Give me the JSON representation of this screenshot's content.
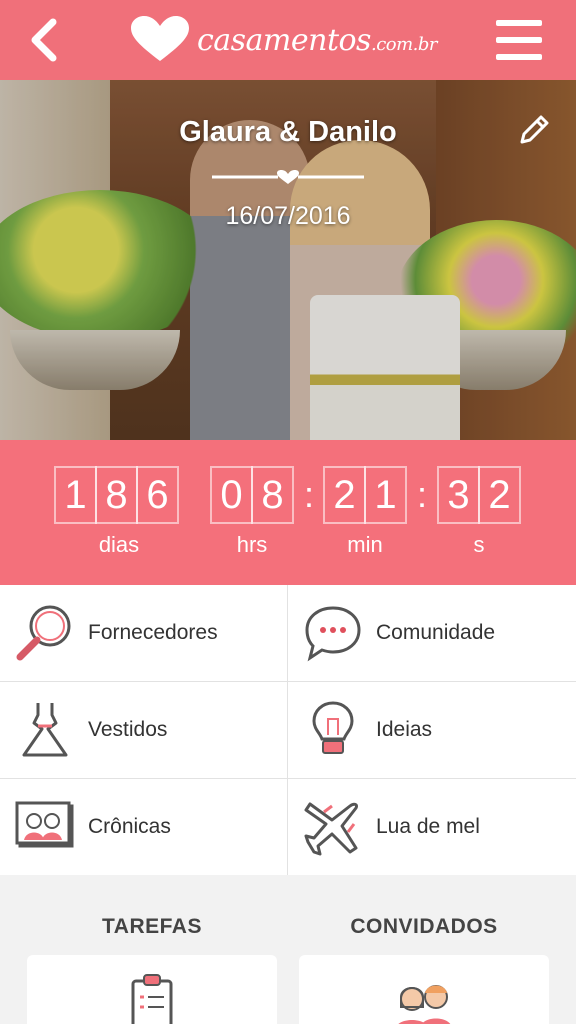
{
  "header": {
    "logo_text": "casamentos",
    "logo_suffix": ".com.br",
    "back_icon": "chevron-left-icon",
    "menu_icon": "hamburger-menu-icon",
    "color": "#f0707a"
  },
  "hero": {
    "couple": "Glaura & Danilo",
    "date": "16/07/2016",
    "edit_icon": "pencil-icon"
  },
  "countdown": {
    "days": [
      "1",
      "8",
      "6"
    ],
    "hours": [
      "0",
      "8"
    ],
    "minutes": [
      "2",
      "1"
    ],
    "seconds": [
      "3",
      "2"
    ],
    "labels": {
      "days": "dias",
      "hours": "hrs",
      "minutes": "min",
      "seconds": "s"
    },
    "color": "#f4707b"
  },
  "menu": [
    {
      "label": "Fornecedores",
      "icon": "magnifier-icon"
    },
    {
      "label": "Comunidade",
      "icon": "chat-bubble-icon"
    },
    {
      "label": "Vestidos",
      "icon": "dress-icon"
    },
    {
      "label": "Ideias",
      "icon": "lightbulb-icon"
    },
    {
      "label": "Crônicas",
      "icon": "photo-frame-icon"
    },
    {
      "label": "Lua de mel",
      "icon": "airplane-icon"
    }
  ],
  "bottom": {
    "tasks_title": "TAREFAS",
    "guests_title": "CONVIDADOS"
  }
}
